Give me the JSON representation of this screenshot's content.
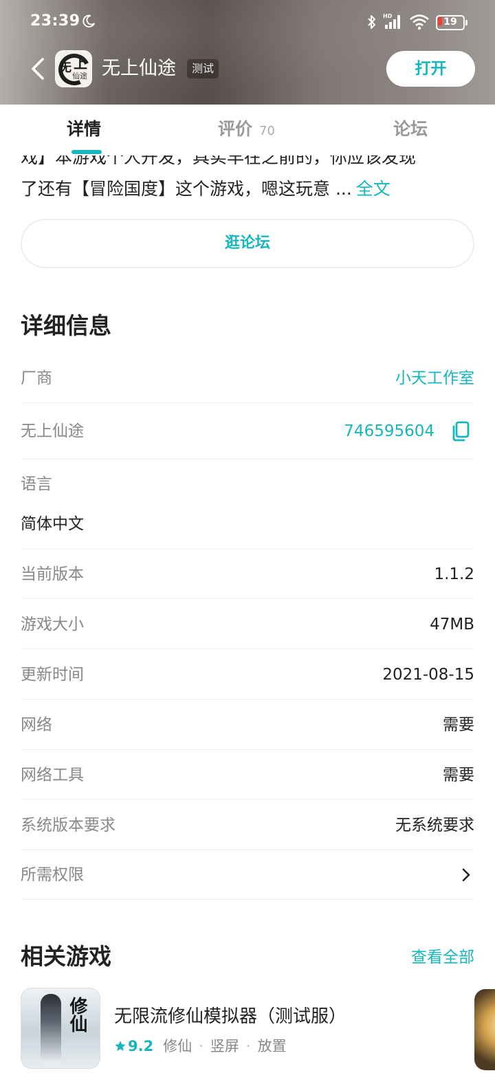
{
  "status_bar": {
    "time": "23:39",
    "battery": "19",
    "network_badge": "HD"
  },
  "header": {
    "logo_text": [
      "无",
      "上",
      "仙途"
    ],
    "title": "无上仙途",
    "badge": "测试",
    "open_label": "打开"
  },
  "tabs": [
    {
      "label": "详情",
      "active": true
    },
    {
      "label": "评价",
      "count": "70",
      "active": false
    },
    {
      "label": "论坛",
      "active": false
    }
  ],
  "intro": {
    "line1": "戏】本游戏个人开发，具实早在之前的，你应该发现",
    "line2": "了还有【冒险国度】这个游戏，嗯这玩意 ...",
    "more": "全文"
  },
  "forum_button": "逛论坛",
  "details": {
    "title": "详细信息",
    "developer": {
      "label": "厂商",
      "value": "小天工作室"
    },
    "group": {
      "label": "无上仙途",
      "value": "746595604"
    },
    "language": {
      "label": "语言",
      "value": "简体中文"
    },
    "version": {
      "label": "当前版本",
      "value": "1.1.2"
    },
    "size": {
      "label": "游戏大小",
      "value": "47MB"
    },
    "updated": {
      "label": "更新时间",
      "value": "2021-08-15"
    },
    "network": {
      "label": "网络",
      "value": "需要"
    },
    "network_tool": {
      "label": "网络工具",
      "value": "需要"
    },
    "os_req": {
      "label": "系统版本要求",
      "value": "无系统要求"
    },
    "permissions": {
      "label": "所需权限"
    }
  },
  "related": {
    "title": "相关游戏",
    "view_all": "查看全部",
    "games": [
      {
        "name": "无限流修仙模拟器（测试服）",
        "thumb_text": "修仙",
        "rating": "9.2",
        "tags": [
          "修仙",
          "竖屏",
          "放置"
        ]
      }
    ]
  },
  "colors": {
    "accent": "#16b6be",
    "battery_low": "#ff3b30"
  }
}
